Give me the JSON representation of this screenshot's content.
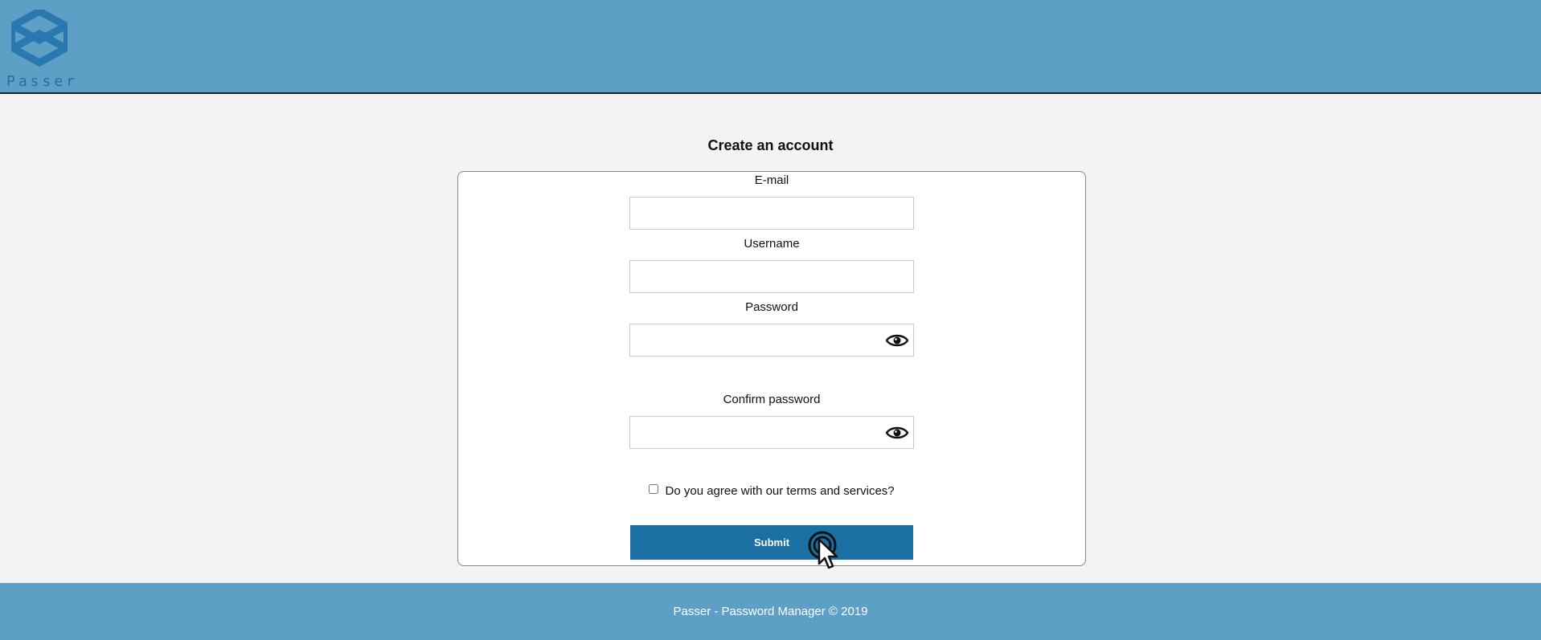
{
  "header": {
    "logo_text": "Passer",
    "logo_icon": "stacked-cube-icon"
  },
  "page": {
    "title": "Create an account"
  },
  "form": {
    "email": {
      "label": "E-mail",
      "value": "",
      "placeholder": ""
    },
    "username": {
      "label": "Username",
      "value": "",
      "placeholder": ""
    },
    "password": {
      "label": "Password",
      "value": "",
      "placeholder": "",
      "toggle_icon": "eye-icon"
    },
    "confirm_password": {
      "label": "Confirm password",
      "value": "",
      "placeholder": "",
      "toggle_icon": "eye-icon"
    },
    "terms_label": "Do you agree with our terms and services?",
    "terms_checked": false,
    "submit_label": "Submit"
  },
  "footer": {
    "text": "Passer - Password Manager © 2019"
  },
  "colors": {
    "header_bg": "#5e9fc6",
    "button_bg": "#1a6fa3",
    "page_bg": "#f3f3f3",
    "logo": "#2a78b0"
  }
}
